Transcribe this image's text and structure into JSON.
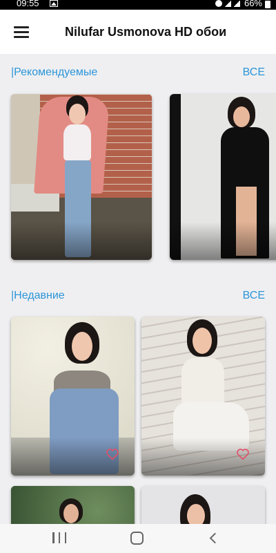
{
  "status_bar": {
    "time": "09:55",
    "battery": "66%",
    "icons": [
      "image-icon",
      "sync-icon",
      "wifi-signal-icon",
      "cell-signal-icon",
      "battery-icon"
    ]
  },
  "app_bar": {
    "title": "Nilufar Usmonova HD обои",
    "menu_icon": "hamburger-menu-icon"
  },
  "sections": {
    "recommended": {
      "title": "|Рекомендуемые",
      "all_label": "ВСЕ"
    },
    "recent": {
      "title": "|Недавние",
      "all_label": "ВСЕ"
    }
  },
  "colors": {
    "accent": "#2b95d8",
    "background": "#efeff1",
    "heart": "#e0506a"
  },
  "bottom_nav": {
    "icons": [
      "recent-apps-icon",
      "home-icon",
      "back-icon"
    ]
  }
}
